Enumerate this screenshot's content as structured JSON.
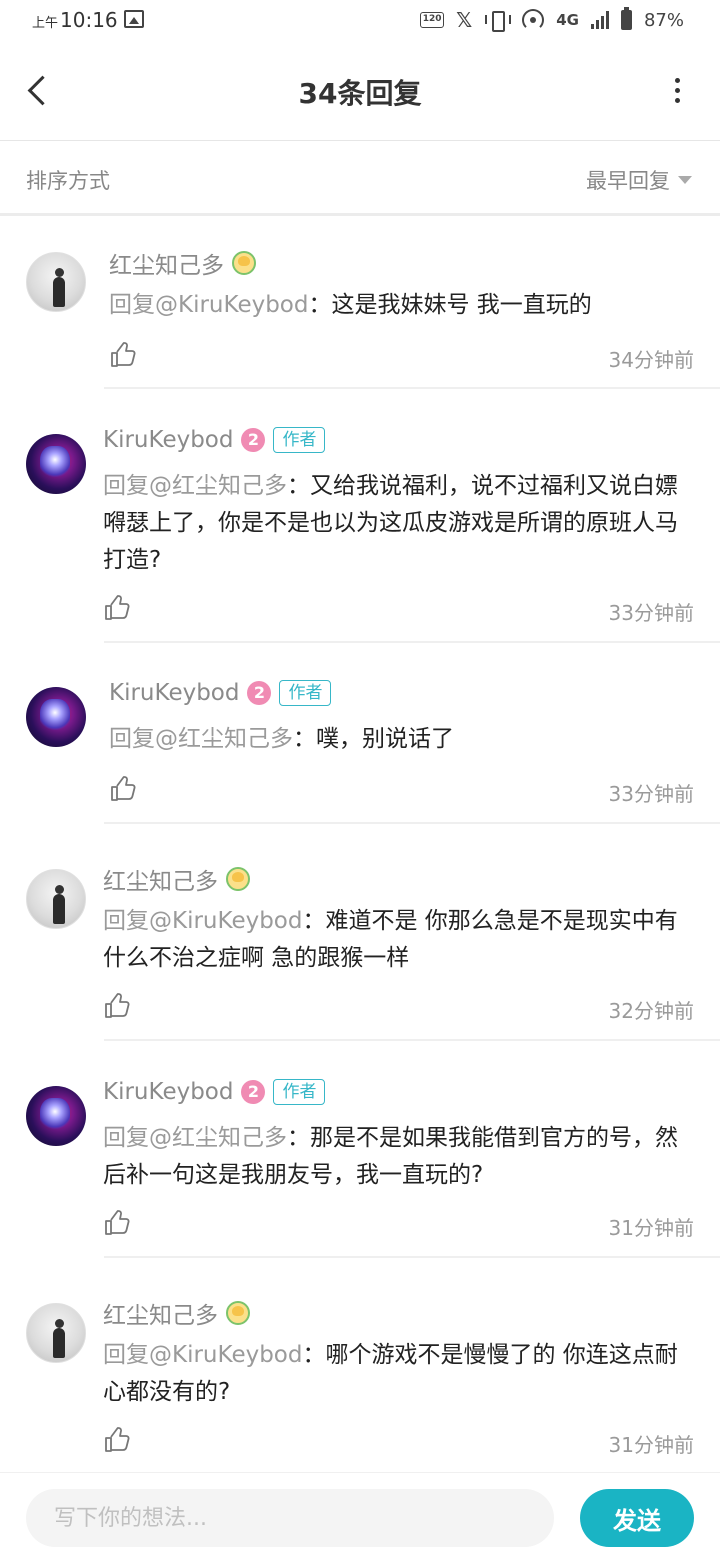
{
  "status_bar": {
    "ampm": "上午",
    "time": "10:16",
    "hz_label": "120",
    "network": "4G",
    "battery": "87%"
  },
  "nav": {
    "title": "34条回复"
  },
  "sort": {
    "label": "排序方式",
    "selected": "最早回复"
  },
  "comments": [
    {
      "user": "红尘知己多",
      "is_author": false,
      "mention": "回复@KiruKeybod",
      "text": "：这是我妹妹号 我一直玩的",
      "time": "34分钟前"
    },
    {
      "user": "KiruKeybod",
      "is_author": true,
      "badge": "作者",
      "level": "2",
      "mention": "回复@红尘知己多",
      "text": "：又给我说福利，说不过福利又说白嫖嘚瑟上了，你是不是也以为这瓜皮游戏是所谓的原班人马打造?",
      "time": "33分钟前"
    },
    {
      "user": "KiruKeybod",
      "is_author": true,
      "badge": "作者",
      "level": "2",
      "mention": "回复@红尘知己多",
      "text": "：噗，别说话了",
      "time": "33分钟前"
    },
    {
      "user": "红尘知己多",
      "is_author": false,
      "mention": "回复@KiruKeybod",
      "text": "：难道不是 你那么急是不是现实中有什么不治之症啊 急的跟猴一样",
      "time": "32分钟前"
    },
    {
      "user": "KiruKeybod",
      "is_author": true,
      "badge": "作者",
      "level": "2",
      "mention": "回复@红尘知己多",
      "text": "：那是不是如果我能借到官方的号，然后补一句这是我朋友号，我一直玩的?",
      "time": "31分钟前"
    },
    {
      "user": "红尘知己多",
      "is_author": false,
      "mention": "回复@KiruKeybod",
      "text": "：哪个游戏不是慢慢了的 你连这点耐心都没有的?",
      "time": "31分钟前"
    }
  ],
  "input": {
    "placeholder": "写下你的想法...",
    "send_label": "发送"
  }
}
